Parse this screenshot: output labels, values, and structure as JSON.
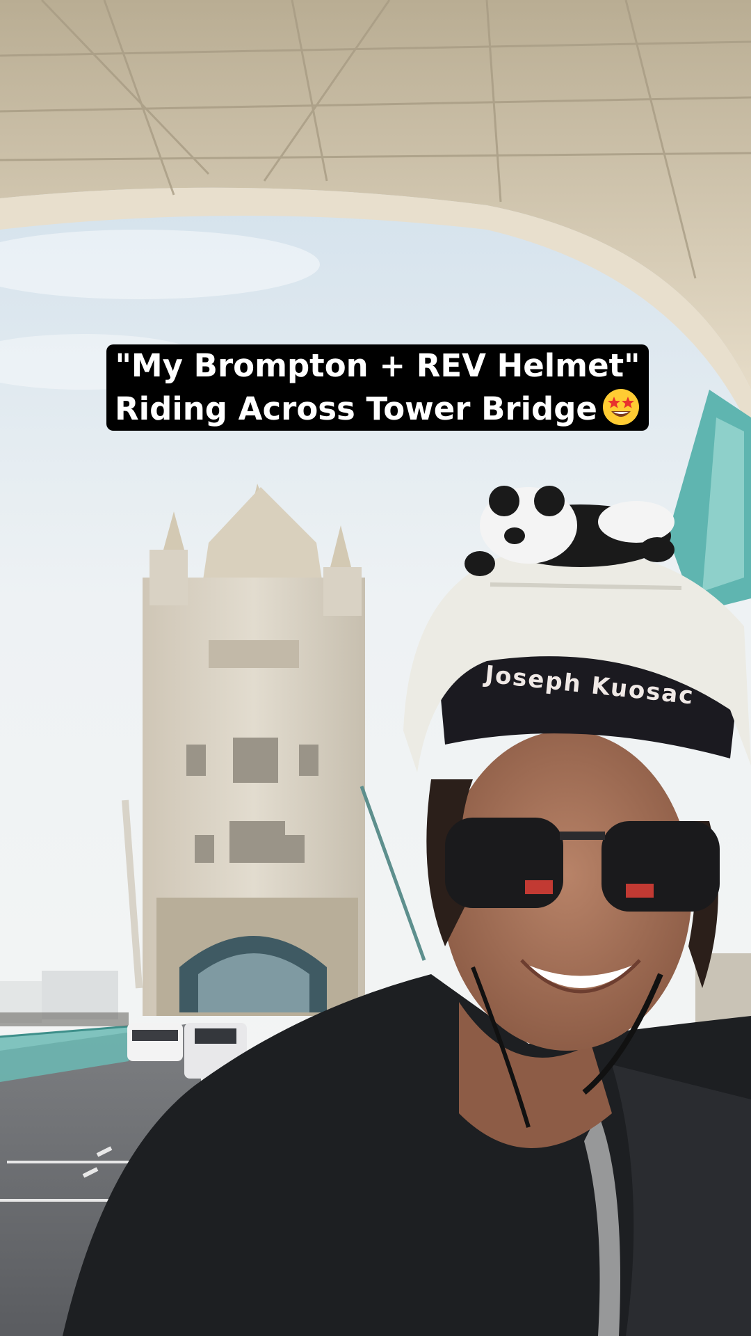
{
  "caption": {
    "line1": "\"My Brompton + REV Helmet\"",
    "line2": "Riding Across Tower Bridge",
    "emoji": "star-struck-emoji"
  },
  "photo": {
    "cap_text": "Joseph Kuosac"
  },
  "colors": {
    "caption_bg": "#000000",
    "caption_text": "#ffffff",
    "sky": "#e9eef2",
    "stone": "#d8ccb4",
    "railing": "#5fb5b0"
  }
}
